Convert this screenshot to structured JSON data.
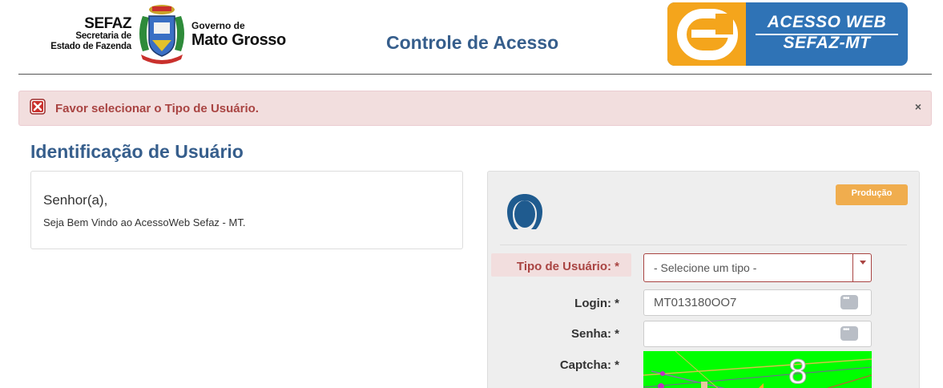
{
  "header": {
    "sefaz_title": "SEFAZ",
    "sefaz_sub_1": "Secretaria de",
    "sefaz_sub_2": "Estado de Fazenda",
    "gov_small": "Governo de",
    "gov_big": "Mato Grosso",
    "page_heading": "Controle de Acesso",
    "acesso_line_1": "ACESSO WEB",
    "acesso_line_2": "SEFAZ-MT"
  },
  "alert": {
    "message": "Favor selecionar o Tipo de Usuário.",
    "close_symbol": "×",
    "icon": "error-x-icon"
  },
  "section": {
    "title": "Identificação de Usuário"
  },
  "welcome": {
    "greeting": "Senhor(a),",
    "message": "Seja Bem Vindo ao AcessoWeb Sefaz - MT."
  },
  "login": {
    "environment_badge": "Produção",
    "user_type_label": "Tipo de Usuário: *",
    "user_type_selected": "- Selecione um tipo -",
    "login_label": "Login: *",
    "login_value": "MT013180OO7",
    "password_label": "Senha: *",
    "password_value": "",
    "captcha_label": "Captcha: *"
  },
  "colors": {
    "brand_blue": "#365e8c",
    "error_red": "#a94442",
    "alert_bg": "#f2dede",
    "badge_orange": "#f0ad4e",
    "logo_orange": "#f4a51c",
    "logo_blue": "#2f73b6",
    "captcha_green": "#00ff00"
  }
}
